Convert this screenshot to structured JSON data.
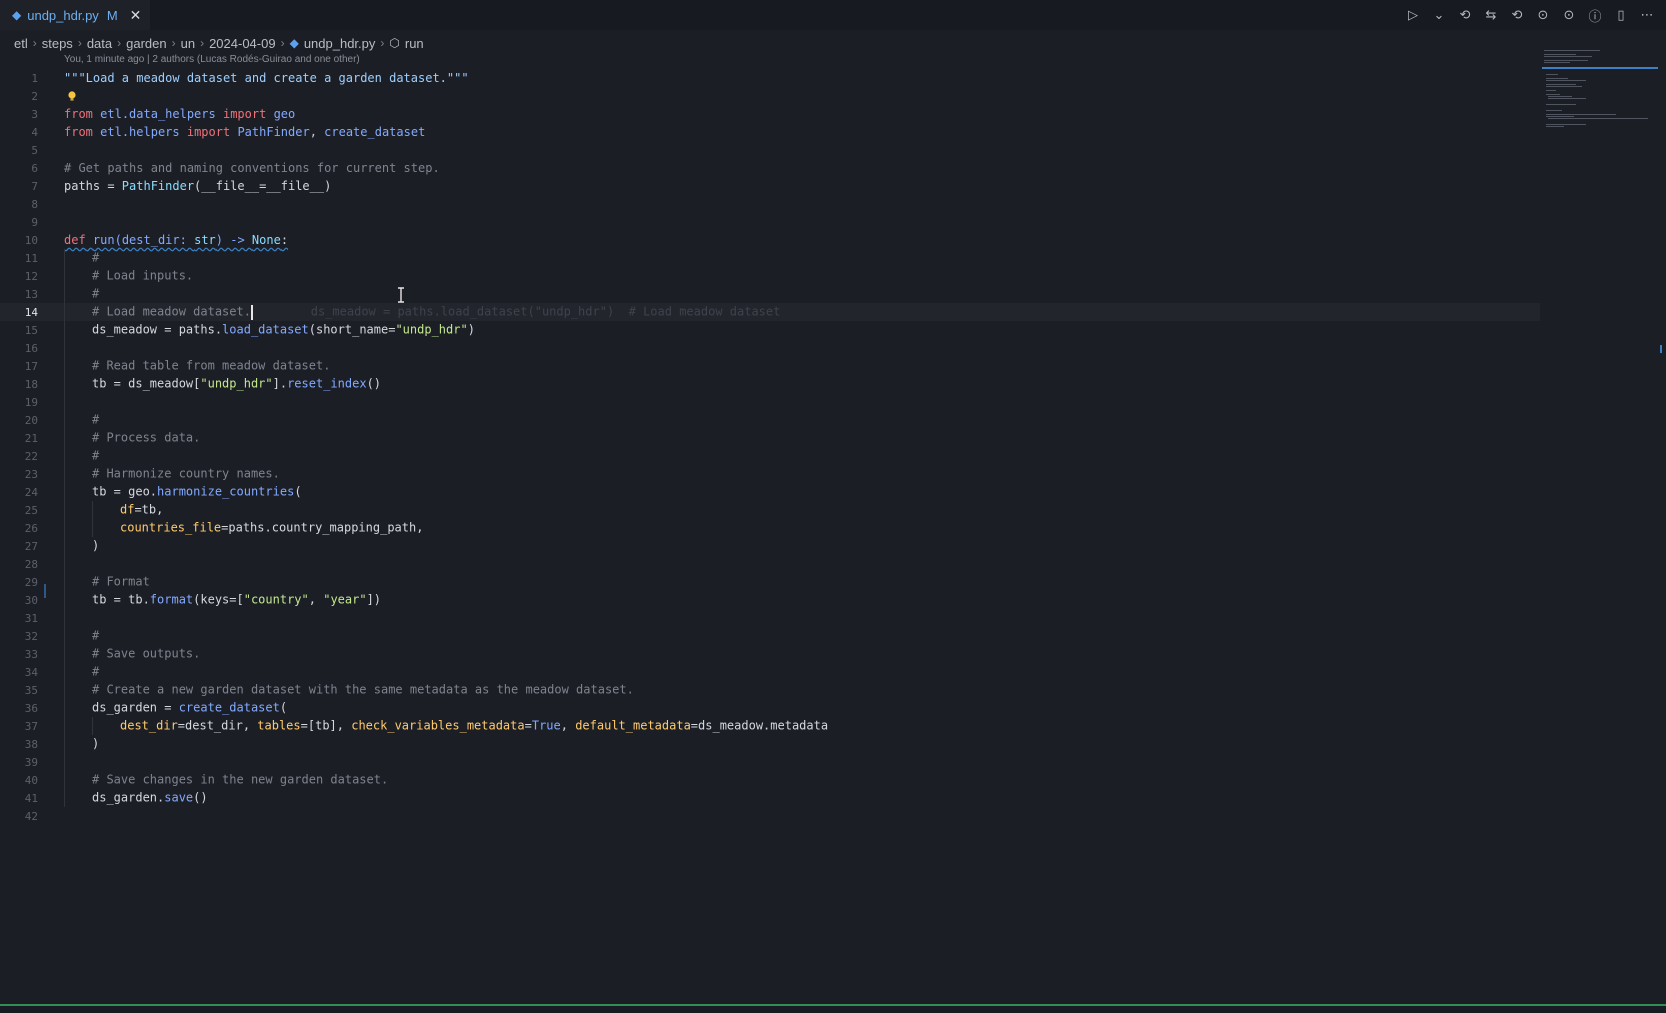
{
  "tab": {
    "filename": "undp_hdr.py",
    "status": "M",
    "close_glyph": "✕"
  },
  "actions": [
    "▷",
    "⌄",
    "⟲",
    "⇆",
    "⟲",
    "⊙",
    "⊙",
    "ⓘ",
    "▯",
    "⋯"
  ],
  "breadcrumb": [
    "etl",
    "steps",
    "data",
    "garden",
    "un",
    "2024-04-09",
    "undp_hdr.py",
    "run"
  ],
  "blame": "You, 1 minute ago | 2 authors (Lucas Rodés-Guirao and one other)",
  "ghost_text": "ds_meadow = paths.load_dataset(\"undp_hdr\")  # Load meadow dataset",
  "line_numbers": [
    "1",
    "2",
    "3",
    "4",
    "5",
    "6",
    "7",
    "8",
    "9",
    "10",
    "11",
    "12",
    "13",
    "14",
    "15",
    "16",
    "17",
    "18",
    "19",
    "20",
    "21",
    "22",
    "23",
    "24",
    "25",
    "26",
    "27",
    "28",
    "29",
    "30",
    "31",
    "32",
    "33",
    "34",
    "35",
    "36",
    "37",
    "38",
    "39",
    "40",
    "41",
    "42"
  ],
  "code": {
    "l1": "\"\"\"Load a meadow dataset and create a garden dataset.\"\"\"",
    "from": "from",
    "import": "import",
    "l3_mod": "etl.data_helpers",
    "l3_name": "geo",
    "l4_mod": "etl.helpers",
    "l4_names_a": "PathFinder",
    "l4_comma": ", ",
    "l4_names_b": "create_dataset",
    "l6": "# Get paths and naming conventions for current step.",
    "l7_a": "paths = ",
    "l7_b": "PathFinder",
    "l7_c": "(__file__=__file__)",
    "l10_def": "def",
    "l10_fn": "run",
    "l10_rest_a": "(dest_dir: ",
    "l10_type": "str",
    "l10_rest_b": ") -> ",
    "l10_none": "None",
    "l10_colon": ":",
    "hash": "#",
    "l12": "# Load inputs.",
    "l14": "# Load meadow dataset.",
    "l15_a": "ds_meadow = paths.",
    "l15_fn": "load_dataset",
    "l15_b": "(short_name=",
    "l15_str": "\"undp_hdr\"",
    "l15_c": ")",
    "l17": "# Read table from meadow dataset.",
    "l18_a": "tb = ds_meadow[",
    "l18_str": "\"undp_hdr\"",
    "l18_b": "].",
    "l18_fn": "reset_index",
    "l18_c": "()",
    "l21": "# Process data.",
    "l23": "# Harmonize country names.",
    "l24_a": "tb = geo.",
    "l24_fn": "harmonize_countries",
    "l24_b": "(",
    "l25_p": "df",
    "l25_rest": "=tb,",
    "l26_p": "countries_file",
    "l26_rest": "=paths.country_mapping_path,",
    "close_paren": ")",
    "l29": "# Format",
    "l30_a": "tb = tb.",
    "l30_fn": "format",
    "l30_b": "(keys=[",
    "l30_s1": "\"country\"",
    "l30_comma": ", ",
    "l30_s2": "\"year\"",
    "l30_c": "])",
    "l33": "# Save outputs.",
    "l35": "# Create a new garden dataset with the same metadata as the meadow dataset.",
    "l36_a": "ds_garden = ",
    "l36_fn": "create_dataset",
    "l36_b": "(",
    "l37_p1": "dest_dir",
    "l37_r1": "=dest_dir, ",
    "l37_p2": "tables",
    "l37_r2": "=[tb], ",
    "l37_p3": "check_variables_metadata",
    "l37_eq": "=",
    "l37_true": "True",
    "l37_comma": ", ",
    "l37_p4": "default_metadata",
    "l37_r4": "=ds_meadow.metadata",
    "l40": "# Save changes in the new garden dataset.",
    "l41_a": "ds_garden.",
    "l41_fn": "save",
    "l41_b": "()"
  },
  "colors": {
    "accent": "#3b7fc7",
    "keyword": "#f07178",
    "function": "#82aaff",
    "string": "#c3e88d",
    "comment": "#7e838d",
    "param": "#ffcb6b"
  }
}
